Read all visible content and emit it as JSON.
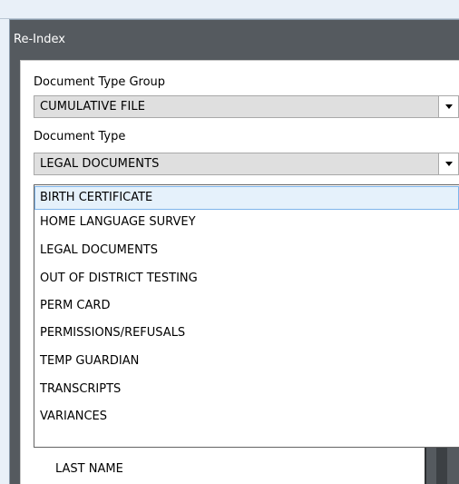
{
  "panel": {
    "title": "Re-Index"
  },
  "document_type_group": {
    "label": "Document Type Group",
    "value": "CUMULATIVE FILE",
    "arrow_icon": "caret-down-icon"
  },
  "document_type": {
    "label": "Document Type",
    "value": "LEGAL DOCUMENTS",
    "arrow_icon": "caret-down-icon",
    "options": [
      "BIRTH CERTIFICATE",
      "HOME LANGUAGE SURVEY",
      "LEGAL DOCUMENTS",
      "OUT OF DISTRICT TESTING",
      "PERM CARD",
      "PERMISSIONS/REFUSALS",
      "TEMP GUARDIAN",
      "TRANSCRIPTS",
      "VARIANCES"
    ],
    "highlighted_option": "BIRTH CERTIFICATE"
  },
  "fields": {
    "last_name_label": "LAST NAME"
  },
  "colors": {
    "panel_bg": "#555a5f",
    "highlight_bg": "#e5f1fb",
    "highlight_border": "#7eb4ea",
    "combo_bg": "#dfdfdf"
  }
}
